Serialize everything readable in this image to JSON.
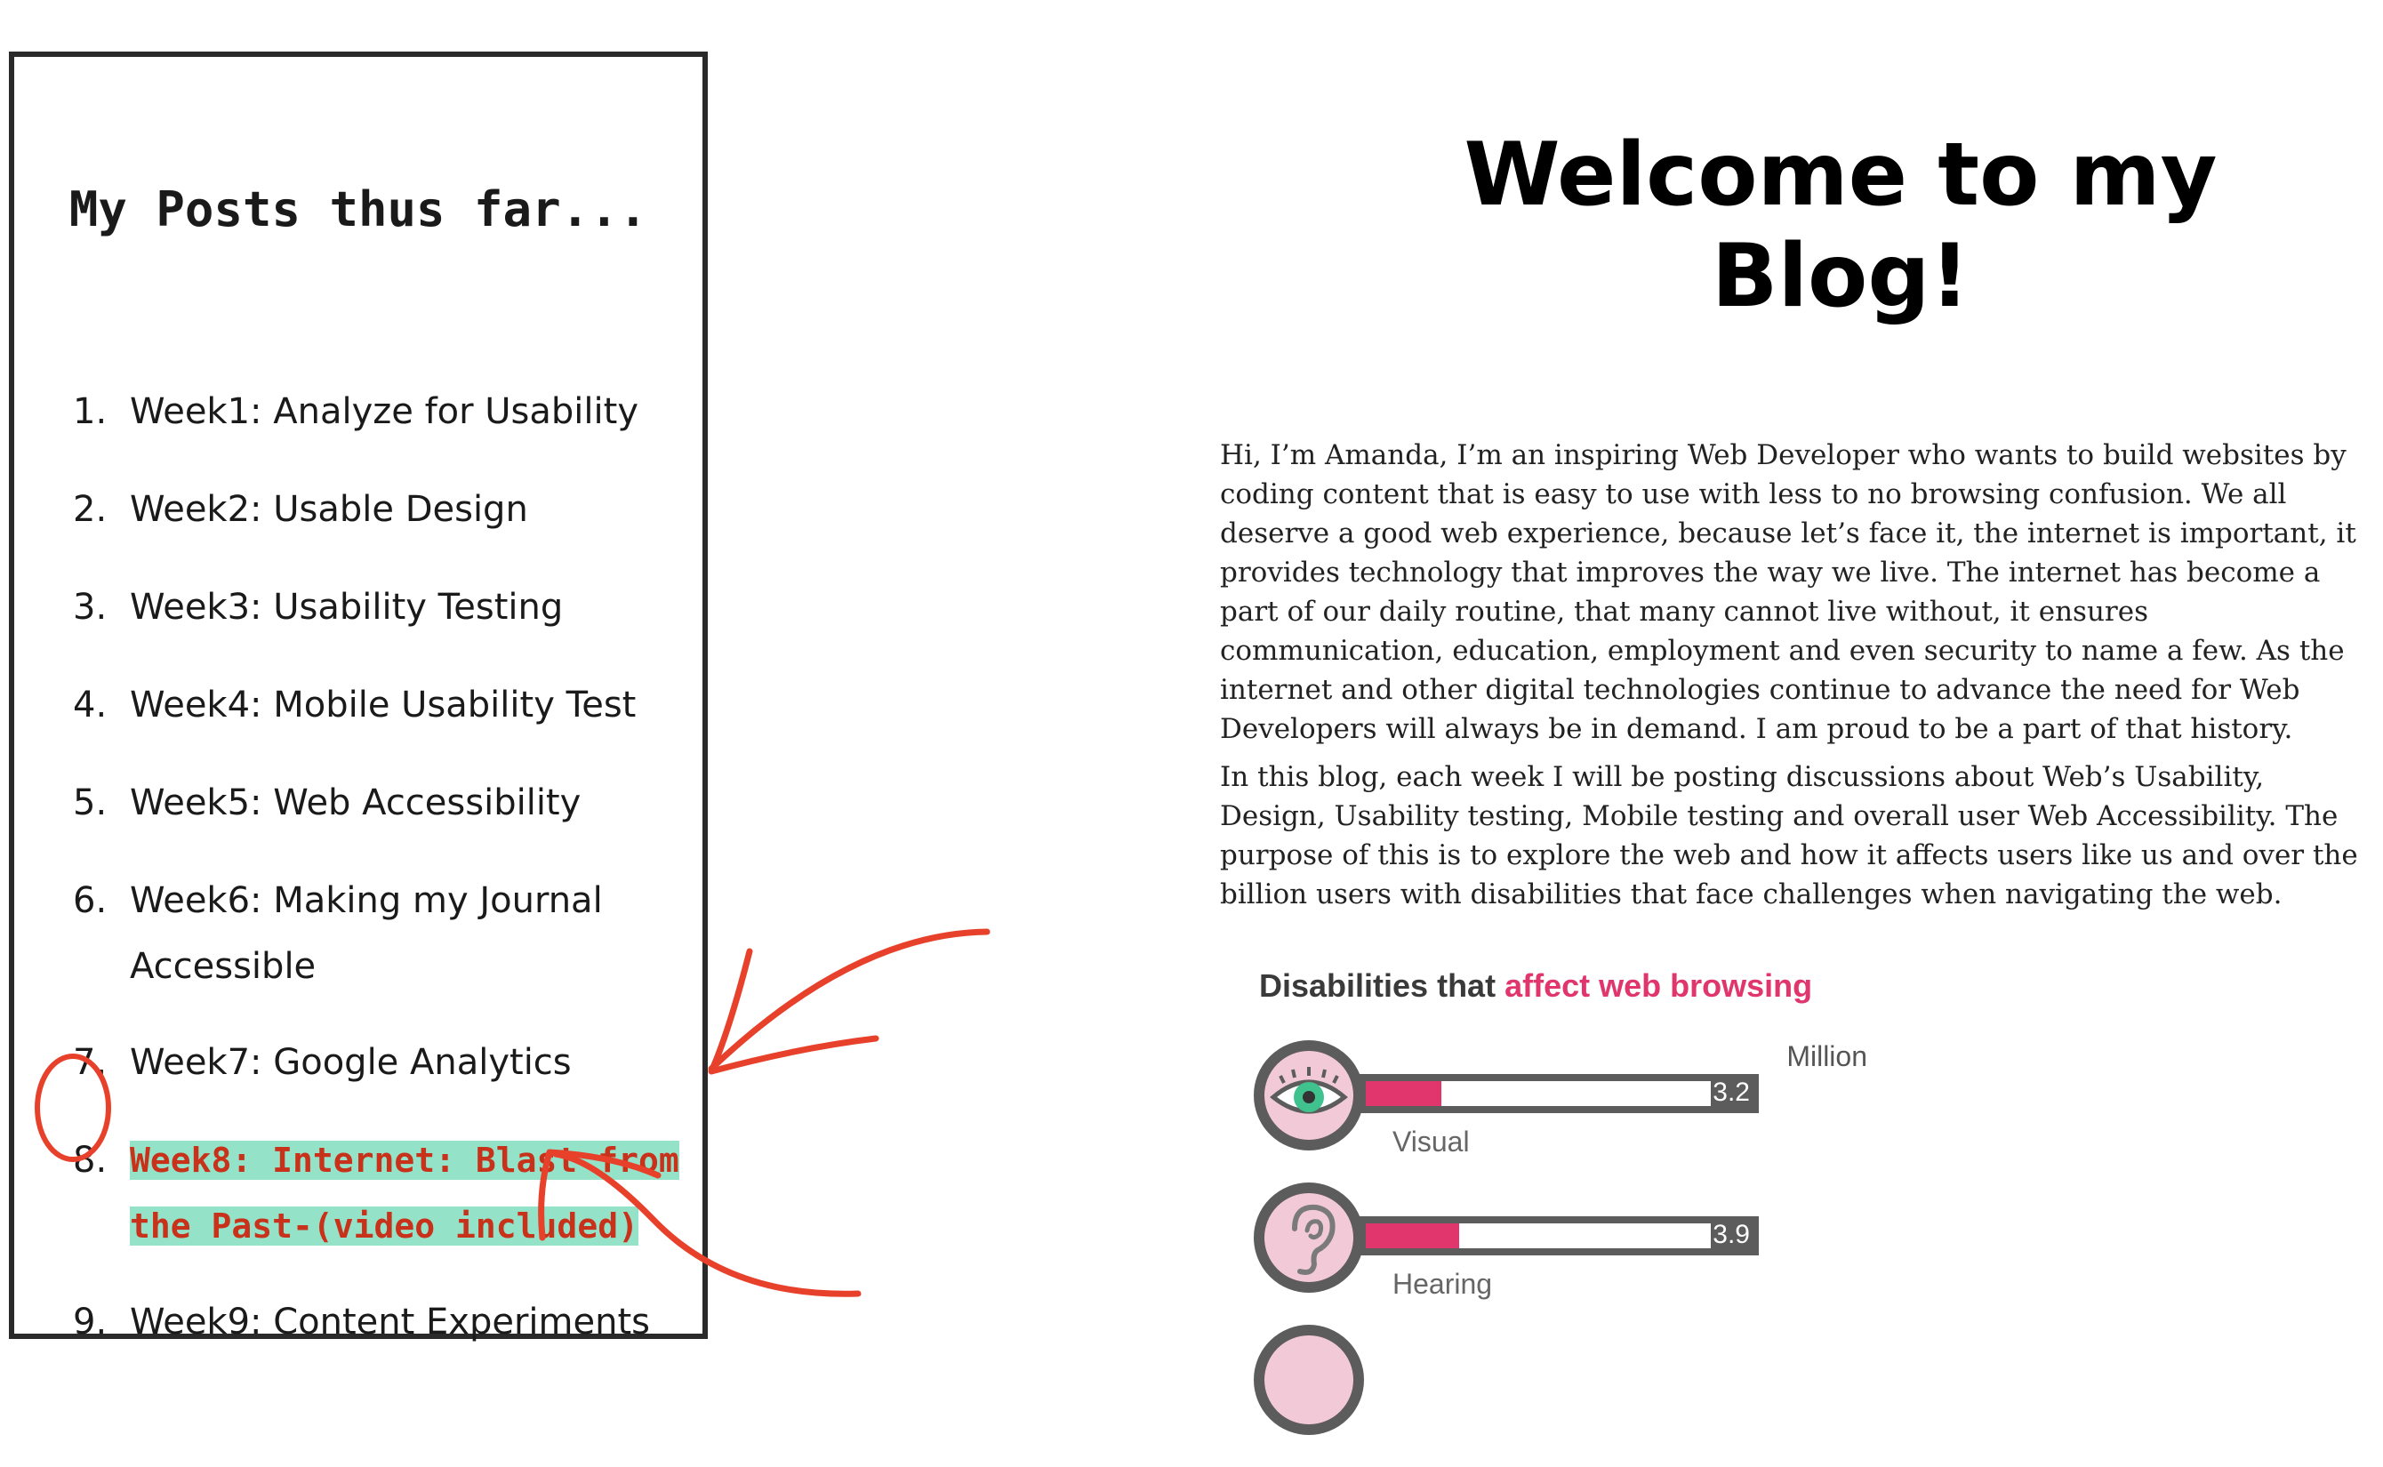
{
  "sidebar": {
    "title": "My Posts thus far...",
    "posts": [
      {
        "number": "1.",
        "label": "Week1: Analyze for Usability"
      },
      {
        "number": "2.",
        "label": "Week2: Usable Design"
      },
      {
        "number": "3.",
        "label": "Week3: Usability Testing"
      },
      {
        "number": "4.",
        "label": "Week4: Mobile Usability Test"
      },
      {
        "number": "5.",
        "label": "Week5: Web Accessibility"
      },
      {
        "number": "6.",
        "label": "Week6: Making my Journal Accessible"
      },
      {
        "number": "7.",
        "label": "Week7: Google Analytics"
      },
      {
        "number": "8.",
        "label": "Week8: Internet: Blast from the Past-(video included)"
      },
      {
        "number": "9.",
        "label": "Week9: Content Experiments"
      }
    ]
  },
  "main": {
    "title": "Welcome to my Blog!",
    "paragraphs": [
      "Hi, I’m Amanda, I’m an inspiring Web Developer who wants to build websites by coding content that is easy to use with less to no browsing confusion. We all deserve a good web experience, because let’s face it, the internet is important, it provides technology that improves the way we live. The internet has become a part of our daily routine, that many cannot live without, it ensures communication, education, employment and even security to name a few. As the internet and other digital technologies continue to advance the need for Web Developers will always be in demand. I am proud to be a part of that history.",
      "In this blog, each week I will be posting discussions about Web’s Usability, Design, Usability testing, Mobile testing and overall user Web Accessibility. The purpose of this is to explore the web and how it affects users like us and over the billion users with disabilities that face challenges when navigating the web."
    ]
  },
  "infographic": {
    "title_prefix": "Disabilities that ",
    "title_accent": "affect web browsing",
    "unit": "Million",
    "accent_color": "#e0356d",
    "rows": [
      {
        "label": "Visual",
        "value": "3.2",
        "fill_fraction": 0.22,
        "icon": "eye-icon"
      },
      {
        "label": "Hearing",
        "value": "3.9",
        "fill_fraction": 0.27,
        "icon": "ear-icon"
      }
    ]
  },
  "annotations": {
    "highlight_color": "#94e3c9",
    "marker_color": "#e8412b"
  }
}
